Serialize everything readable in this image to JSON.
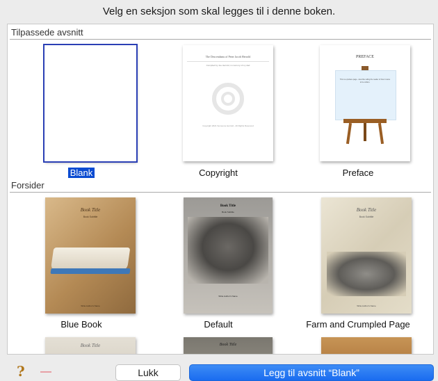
{
  "header": {
    "title": "Velg en seksjon som skal legges til i denne boken."
  },
  "sections": [
    {
      "label": "Tilpassede avsnitt"
    },
    {
      "label": "Forsider"
    }
  ],
  "custom_items": [
    {
      "label": "Blank"
    },
    {
      "label": "Copyright",
      "thumb_title": "The Descendants of Peter Jacob Herrold",
      "thumb_sub": "Compiled by Joe Herrold, in memory of my dad",
      "thumb_foot": "Copyright 2021 Someone Herrold - All Rights Reserved"
    },
    {
      "label": "Preface",
      "thumb_title": "PREFACE",
      "thumb_text": "This is a preface page - describe telling the reader of how it came to be written."
    }
  ],
  "cover_items": [
    {
      "label": "Blue Book",
      "thumb_title": "Book Title",
      "thumb_sub": "Book Subtitle",
      "thumb_foot": "Write Author's Name"
    },
    {
      "label": "Default",
      "thumb_title": "Book Title",
      "thumb_sub": "Book Subtitle",
      "thumb_foot": "Write Author's Name"
    },
    {
      "label": "Farm and Crumpled Page",
      "thumb_title": "Book Title",
      "thumb_sub": "Book Subtitle",
      "thumb_foot": "Write Author's Name"
    }
  ],
  "partial_items": [
    {
      "thumb_title": "Book Title"
    },
    {
      "thumb_title": "Book Title"
    },
    {
      "thumb_title": ""
    }
  ],
  "footer": {
    "help_icon": "question-mark-icon",
    "remove_icon": "minus-icon",
    "close_label": "Lukk",
    "add_label": "Legg til avsnitt “Blank”"
  }
}
